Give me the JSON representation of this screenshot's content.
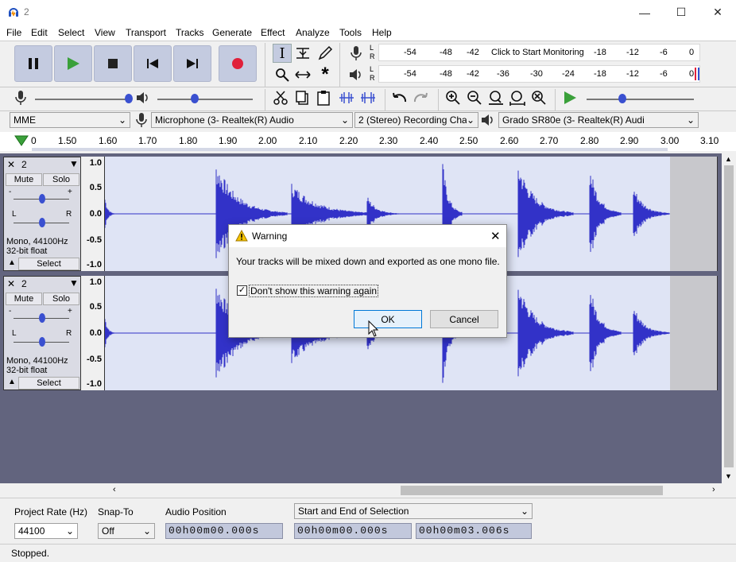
{
  "window": {
    "title": "2",
    "minimize": "—",
    "maximize": "☐",
    "close": "✕"
  },
  "menu": [
    "File",
    "Edit",
    "Select",
    "View",
    "Transport",
    "Tracks",
    "Generate",
    "Effect",
    "Analyze",
    "Tools",
    "Help"
  ],
  "meters": {
    "record_scale": [
      "-54",
      "-48",
      "-42",
      "Click to Start Monitoring",
      "-18",
      "-12",
      "-6",
      "0"
    ],
    "play_scale": [
      "-54",
      "-48",
      "-42",
      "-36",
      "-30",
      "-24",
      "-18",
      "-12",
      "-6",
      "0"
    ],
    "lr": [
      "L",
      "R"
    ]
  },
  "devices": {
    "host": "MME",
    "recording_device": "Microphone (3- Realtek(R) Audio",
    "channels": "2 (Stereo) Recording Chan",
    "playback_device": "Grado SR80e (3- Realtek(R) Audi"
  },
  "ruler": [
    "0",
    "1.50",
    "1.60",
    "1.70",
    "1.80",
    "1.90",
    "2.00",
    "2.10",
    "2.20",
    "2.30",
    "2.40",
    "2.50",
    "2.60",
    "2.70",
    "2.80",
    "2.90",
    "3.00",
    "3.10"
  ],
  "tracks": [
    {
      "name": "2",
      "mute": "Mute",
      "solo": "Solo",
      "info1": "Mono, 44100Hz",
      "info2": "32-bit float",
      "select": "Select",
      "gain_plus": "+",
      "gain_minus": "-",
      "pan_l": "L",
      "pan_r": "R",
      "scale": [
        "1.0",
        "0.5",
        "0.0",
        "-0.5",
        "-1.0"
      ]
    },
    {
      "name": "2",
      "mute": "Mute",
      "solo": "Solo",
      "info1": "Mono, 44100Hz",
      "info2": "32-bit float",
      "select": "Select",
      "gain_plus": "+",
      "gain_minus": "-",
      "pan_l": "L",
      "pan_r": "R",
      "scale": [
        "1.0",
        "0.5",
        "0.0",
        "-0.5",
        "-1.0"
      ]
    }
  ],
  "bottom": {
    "project_rate_label": "Project Rate (Hz)",
    "project_rate": "44100",
    "snap_label": "Snap-To",
    "snap": "Off",
    "audio_position_label": "Audio Position",
    "audio_position": "00h00m00.000s",
    "selection_mode": "Start and End of Selection",
    "sel_start": "00h00m00.000s",
    "sel_end": "00h00m03.006s"
  },
  "status": "Stopped.",
  "dialog": {
    "title": "Warning",
    "message": "Your tracks will be mixed down and exported as one mono file.",
    "checkbox_label": "Don't show this warning again",
    "checkbox_checked": true,
    "ok": "OK",
    "cancel": "Cancel"
  },
  "colors": {
    "waveform": "#3232c8",
    "wave_bg": "#dfe4f5",
    "track_bg": "#62647e",
    "record": "#e0203a",
    "play": "#3aa03a"
  }
}
